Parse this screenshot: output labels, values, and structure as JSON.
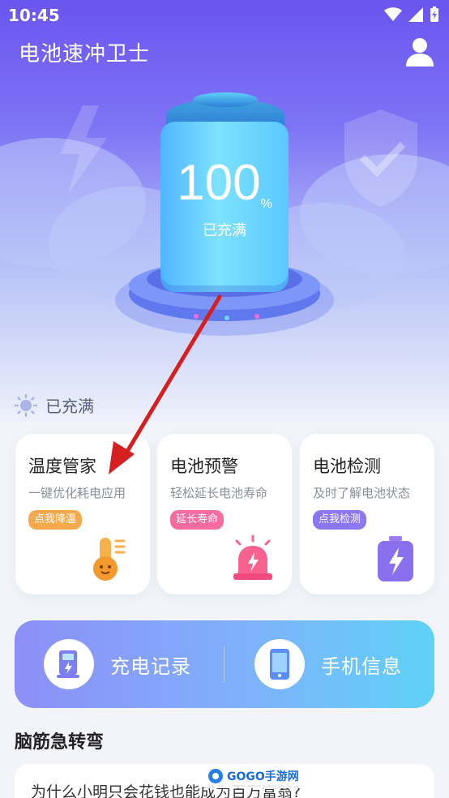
{
  "status_bar": {
    "time": "10:45"
  },
  "app_bar": {
    "title": "电池速冲卫士",
    "user_icon": "user-icon"
  },
  "battery": {
    "percent": "100",
    "unit": "%",
    "state": "已充满"
  },
  "status_line": {
    "icon": "sun-icon",
    "text": "已充满"
  },
  "cards": [
    {
      "title": "温度管家",
      "desc": "一键优化耗电应用",
      "pill": "点我降温",
      "pill_color": "#f5a94c",
      "icon": "thermometer-icon"
    },
    {
      "title": "电池预警",
      "desc": "轻松延长电池寿命",
      "pill": "延长寿命",
      "pill_color": "#f76b9f",
      "icon": "alarm-icon"
    },
    {
      "title": "电池检测",
      "desc": "及时了解电池状态",
      "pill": "点我检测",
      "pill_color": "#8b78f0",
      "icon": "battery-bolt-icon"
    }
  ],
  "actions": [
    {
      "label": "充电记录",
      "icon": "charging-station-icon"
    },
    {
      "label": "手机信息",
      "icon": "phone-icon"
    }
  ],
  "riddles": {
    "title": "脑筋急转弯",
    "question": "为什么小明只会花钱也能成为百万富翁?"
  },
  "watermark": {
    "text": "GOGO手游网"
  },
  "colors": {
    "accent": "#6a55f0",
    "bar_start": "#8c8ff7",
    "bar_end": "#5fd2f7"
  }
}
